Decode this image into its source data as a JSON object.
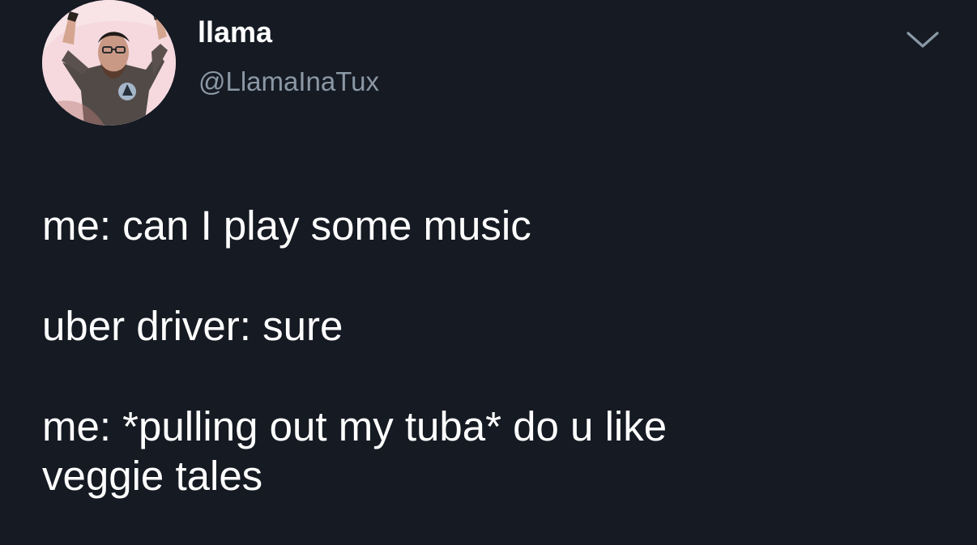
{
  "author": {
    "display_name": "llama",
    "handle": "@LlamaInaTux",
    "avatar_icon": "user-avatar-photo"
  },
  "actions": {
    "menu_icon": "chevron-down-icon"
  },
  "tweet": {
    "lines": [
      "me: can I play some music",
      "uber driver: sure",
      "me: *pulling out my tuba* do u like",
      "veggie tales"
    ]
  },
  "colors": {
    "background": "#151a23",
    "primary_text": "#ffffff",
    "secondary_text": "#8b98a5"
  }
}
